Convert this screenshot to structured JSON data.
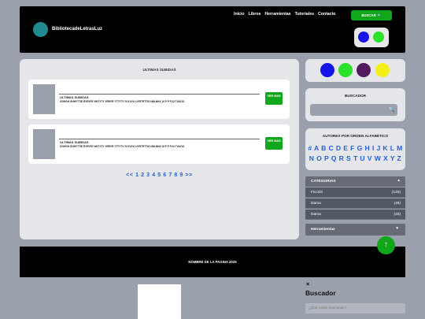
{
  "header": {
    "logo_text": "BibliotecadeLetrasLuz",
    "nav": [
      "Inicio",
      "Libros",
      "Herramientas",
      "Tutoriales",
      "Contacto"
    ],
    "search_button": "BUSCAR",
    "search_button_icon": "🔍",
    "theme_colors": [
      "#1515e6",
      "#2ae22a"
    ]
  },
  "main": {
    "title": "ULTIMAS SUBIDAS",
    "cards": [
      {
        "title": "ULTIMAS SUBIDAS",
        "description": "GGHGH GHHYTTIE RYRYRY NNTYTY YRRYR YTTYTY YUYUYU UYRTRTTIG NNLNKK UI P P PJU TUUOO",
        "more": "VER MAS"
      },
      {
        "title": "ULTIMAS SUBIDAS",
        "description": "GGHGH GHHYTTIE RYRYRY NNTYTY YRRYR YTTYTY YUYUYU UYRTRTTIG NNLNKK UI P P PJU TUUOO",
        "more": "VER MAS"
      }
    ],
    "pagination": "<< 1 2 3 4 5 6 7 8 9 >>"
  },
  "sidebar": {
    "palette_colors": [
      "#1515e6",
      "#2ae22a",
      "#4f1a5e",
      "#f5ef19"
    ],
    "search_title": "BUSCADOR",
    "search_icon": "🔍",
    "authors_title": "AUTORES POR ORDEN ALFABÉTICO",
    "letters_row1": "# A B C D E F G H I J K L M",
    "letters_row2": "N O P Q R S T U V W X Y Z",
    "categories_label": "CATEGORIAS",
    "categories_arrow": "▲",
    "categories": [
      {
        "label": "Ficción",
        "count": "(125)"
      },
      {
        "label": "Dama",
        "count": "(46)"
      },
      {
        "label": "Dama",
        "count": "(46)"
      }
    ],
    "tools_label": "Herramientas",
    "tools_arrow": "▼"
  },
  "fab_icon": "↑",
  "footer": {
    "text": "NOMBRE DE LA PAGINA 2025"
  },
  "overlay": {
    "close": "×",
    "title": "Buscador",
    "placeholder": "¿Qué estás buscando?"
  }
}
